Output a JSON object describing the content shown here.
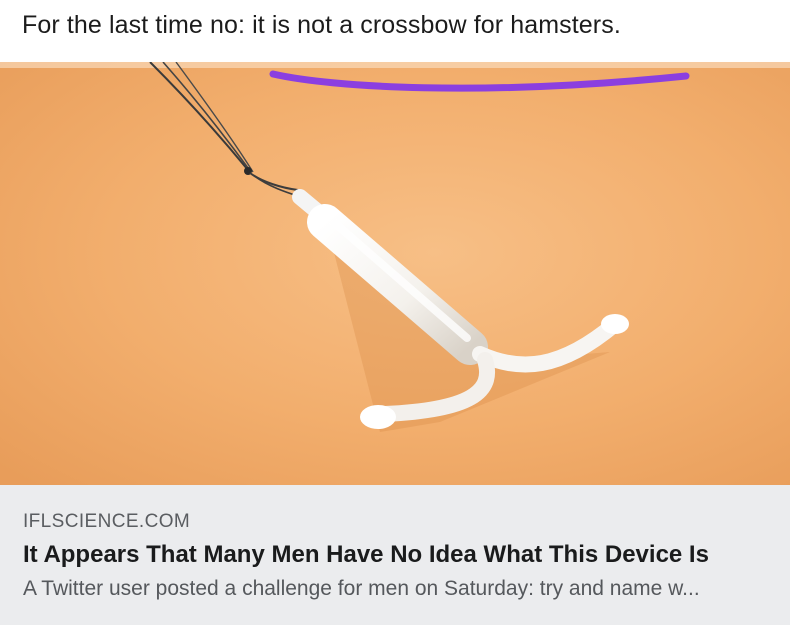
{
  "post": {
    "caption": "For the last time no: it is not a crossbow for hamsters."
  },
  "link_preview": {
    "image": {
      "subject": "white T-shaped device on orange background",
      "background_color": "#f1ad6c",
      "annotation_stroke_color": "#8b3fe0"
    },
    "domain": "IFLSCIENCE.COM",
    "title": "It Appears That Many Men Have No Idea What This Device Is",
    "description": "A Twitter user posted a challenge for men on Saturday: try and name w..."
  },
  "colors": {
    "card_background": "#ebecee",
    "title_text": "#1a1b1c",
    "secondary_text": "#55585c"
  }
}
